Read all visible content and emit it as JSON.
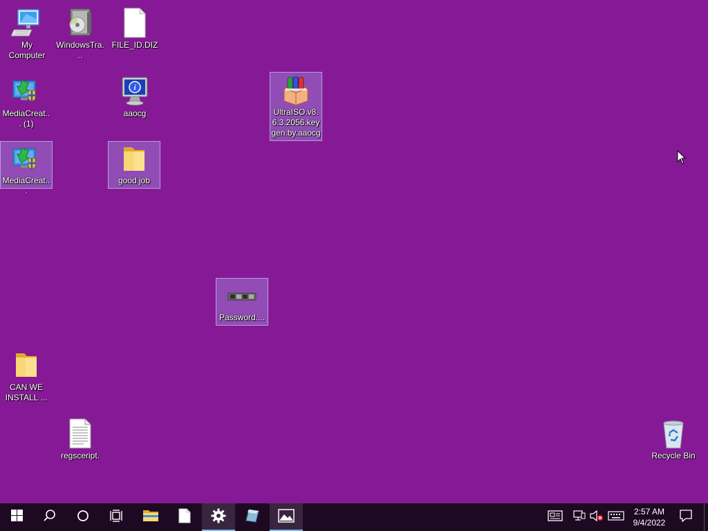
{
  "desktop": {
    "background_color": "#861a96",
    "icons": [
      {
        "label": "My Computer",
        "icon": "computer-icon",
        "selected": false
      },
      {
        "label": "WindowsTra...",
        "icon": "installer-disc-icon",
        "selected": false
      },
      {
        "label": "FILE_ID.DIZ",
        "icon": "blank-file-icon",
        "selected": false
      },
      {
        "label": "MediaCreat... (1)",
        "icon": "media-creation-tool-icon",
        "selected": false
      },
      {
        "label": "aaocg",
        "icon": "info-monitor-icon",
        "selected": false
      },
      {
        "label": "UltraISO.v8.6.3.2056.keygen.by.aaocg",
        "icon": "winrar-archive-icon",
        "selected": true
      },
      {
        "label": "MediaCreat...",
        "icon": "media-creation-tool-icon",
        "selected": true
      },
      {
        "label": "good job",
        "icon": "folder-icon",
        "selected": true
      },
      {
        "label": "Password....",
        "icon": "password-image-icon",
        "selected": true
      },
      {
        "label": "CAN WE INSTALL ...",
        "icon": "folder-icon",
        "selected": false
      },
      {
        "label": "regsceript.",
        "icon": "text-file-icon",
        "selected": false
      },
      {
        "label": "Recycle Bin",
        "icon": "recycle-bin-icon",
        "selected": false
      }
    ]
  },
  "taskbar": {
    "buttons": [
      {
        "name": "start-button",
        "icon": "windows-logo-icon"
      },
      {
        "name": "search-button",
        "icon": "search-icon"
      },
      {
        "name": "cortana-button",
        "icon": "cortana-circle-icon"
      },
      {
        "name": "task-view-button",
        "icon": "task-view-icon"
      },
      {
        "name": "file-explorer-button",
        "icon": "folder-icon"
      },
      {
        "name": "notepad-button",
        "icon": "document-icon"
      },
      {
        "name": "settings-button",
        "icon": "gear-icon",
        "active": true
      },
      {
        "name": "app-button",
        "icon": "app-tile-icon"
      },
      {
        "name": "photos-button",
        "icon": "photos-icon",
        "active": true
      }
    ],
    "tray": {
      "time": "2:57 AM",
      "date": "9/4/2022"
    }
  }
}
